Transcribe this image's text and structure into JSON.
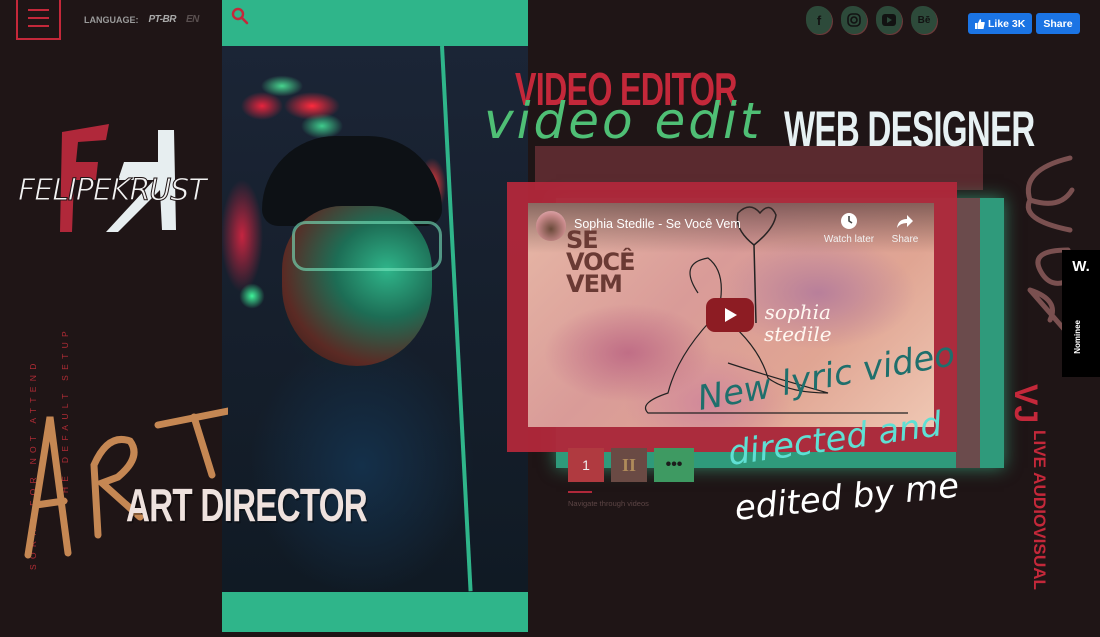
{
  "header": {
    "language_label": "LANGUAGE:",
    "languages": [
      {
        "code": "PT-BR",
        "active": true
      },
      {
        "code": "EN",
        "active": false
      }
    ],
    "menu_icon": "hamburger-menu-icon",
    "search_icon": "search-icon"
  },
  "social": {
    "icons": [
      "facebook-icon",
      "instagram-icon",
      "youtube-icon",
      "behance-icon"
    ],
    "facebook_glyph": "f",
    "behance_glyph": "Bē",
    "like_label": "Like 3K",
    "share_label": "Share"
  },
  "brand": {
    "logo_text": "FELIPEKRUST",
    "monogram": "FK"
  },
  "side_notes": {
    "line1": "SORRY FOR NOT ATTEND",
    "line2": "THE DEFAULT SETUP"
  },
  "roles": {
    "art_script": "ART",
    "art_director": "ART DIRECTOR",
    "video_editor": "VIDEO EDITOR",
    "video_script": "video edit",
    "web_designer": "WEB DESIGNER",
    "web_script": "WEB",
    "vj": "VJ",
    "live_audiovisual": "LIVE AUDIOVISUAL"
  },
  "video": {
    "title": "Sophia Stedile - Se Você Vem",
    "watch_later": "Watch later",
    "share": "Share",
    "cover_title_lines": [
      "SE",
      "VOCÊ",
      "VEM"
    ],
    "cover_script": [
      "sophia",
      "stedile"
    ]
  },
  "pager": {
    "items": [
      "1",
      "II",
      "•••"
    ],
    "hint": "Navigate through videos"
  },
  "lyric_note": {
    "line1": "New lyric video",
    "line2": "directed and",
    "line3": "edited by me"
  },
  "award": {
    "logo": "W.",
    "label": "Nominee"
  },
  "colors": {
    "background": "#1f1516",
    "red": "#c4283a",
    "teal": "#2fb58a",
    "facebook": "#1b74e4"
  }
}
